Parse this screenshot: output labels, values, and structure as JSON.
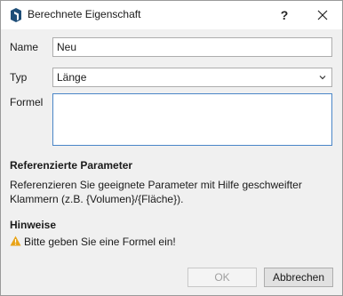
{
  "dialog": {
    "title": "Berechnete Eigenschaft",
    "help": "?"
  },
  "form": {
    "name_label": "Name",
    "name_value": "Neu",
    "type_label": "Typ",
    "type_value": "Länge",
    "formula_label": "Formel",
    "formula_value": ""
  },
  "params": {
    "heading": "Referenzierte Parameter",
    "text": "Referenzieren Sie geeignete Parameter mit Hilfe geschweifter Klammern (z.B. {Volumen}/{Fläche})."
  },
  "hints": {
    "heading": "Hinweise",
    "warning": "Bitte geben Sie eine Formel ein!"
  },
  "buttons": {
    "ok": "OK",
    "cancel": "Abbrechen"
  },
  "colors": {
    "warning": "#e8a317",
    "app_icon": "#1e4e78",
    "focus_border": "#4a86c7"
  }
}
